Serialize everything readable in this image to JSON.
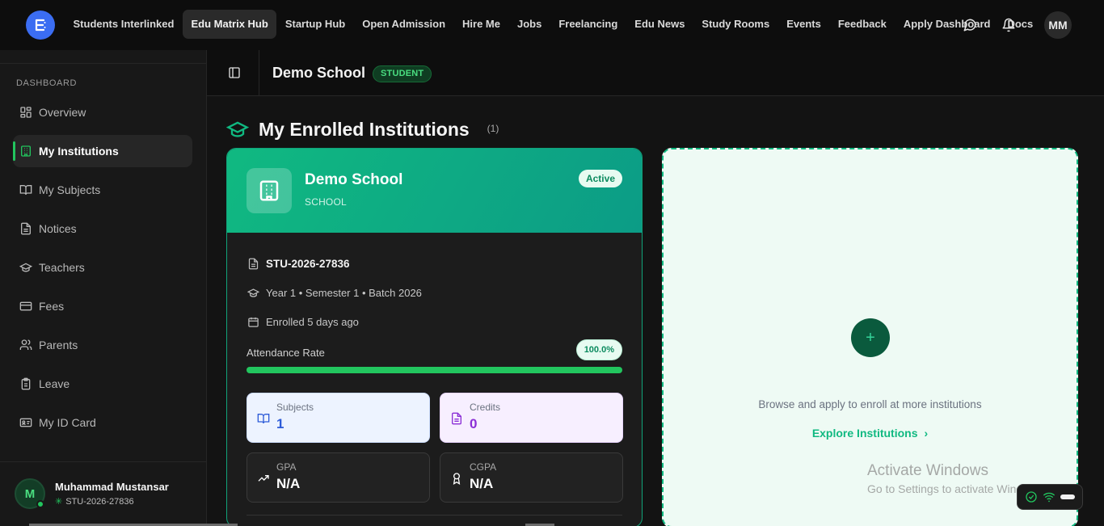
{
  "nav": {
    "logo_letter": "E",
    "links": [
      "Students Interlinked",
      "Edu Matrix Hub",
      "Startup Hub",
      "Open Admission",
      "Hire Me",
      "Jobs",
      "Freelancing",
      "Edu News",
      "Study Rooms",
      "Events",
      "Feedback",
      "Apply Dashboard",
      "Docs"
    ],
    "active_index": 1,
    "icons": [
      "chat-icon",
      "bell-icon"
    ],
    "user_initials": "MM"
  },
  "sidebar": {
    "heading": "DASHBOARD",
    "items": [
      {
        "label": "Overview",
        "icon": "grid-icon"
      },
      {
        "label": "My Institutions",
        "icon": "building-icon",
        "active": true
      },
      {
        "label": "My Subjects",
        "icon": "book-icon"
      },
      {
        "label": "Notices",
        "icon": "file-icon"
      },
      {
        "label": "Teachers",
        "icon": "graduation-cap-icon"
      },
      {
        "label": "Fees",
        "icon": "credit-card-icon"
      },
      {
        "label": "Parents",
        "icon": "users-icon"
      },
      {
        "label": "Leave",
        "icon": "clipboard-icon"
      },
      {
        "label": "My ID Card",
        "icon": "id-card-icon"
      }
    ],
    "user": {
      "initial": "M",
      "name": "Muhammad Mustansar",
      "id": "STU-2026-27836"
    }
  },
  "header": {
    "school": "Demo School",
    "role_badge": "STUDENT"
  },
  "main": {
    "title": "My Enrolled Institutions",
    "count": "(1)",
    "card": {
      "name": "Demo School",
      "type": "SCHOOL",
      "status": "Active",
      "student_id": "STU-2026-27836",
      "program": "Year 1 • Semester 1 • Batch 2026",
      "enrolled": "Enrolled 5 days ago",
      "attendance_label": "Attendance Rate",
      "attendance_pct": "100.0%",
      "attendance_value": 100,
      "stats": [
        {
          "label": "Subjects",
          "value": "1"
        },
        {
          "label": "Credits",
          "value": "0"
        },
        {
          "label": "GPA",
          "value": "N/A"
        },
        {
          "label": "CGPA",
          "value": "N/A"
        }
      ]
    },
    "add_card": {
      "plus": "+",
      "text": "Browse and apply to enroll at more institutions",
      "link": "Explore Institutions",
      "chevron": "›"
    }
  },
  "overlay": {
    "watermark_title": "Activate Windows",
    "watermark_sub": "Go to Settings to activate Windows."
  },
  "colors": {
    "accent": "#10b981",
    "active_green": "#22c55e",
    "logo_blue": "#3b6df2"
  }
}
